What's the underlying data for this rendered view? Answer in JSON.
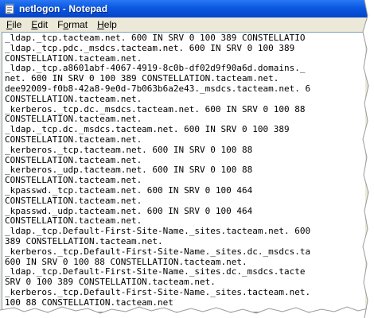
{
  "window": {
    "title": "netlogon - Notepad"
  },
  "menu": [
    {
      "first": "F",
      "rest": "ile"
    },
    {
      "first": "E",
      "rest": "dit"
    },
    {
      "first": "F",
      "rest": "ormat",
      "underline_index": 1
    },
    {
      "first": "H",
      "rest": "elp"
    }
  ],
  "menu_labels": [
    "File",
    "Edit",
    "Format",
    "Help"
  ],
  "editor": {
    "lines": [
      "_ldap._tcp.tacteam.net. 600 IN SRV 0 100 389 CONSTELLATIO",
      "_ldap._tcp.pdc._msdcs.tacteam.net. 600 IN SRV 0 100 389",
      "CONSTELLATION.tacteam.net.",
      "_ldap._tcp.a8601abf-4067-4919-8c0b-df02d9f90a6d.domains._",
      "net. 600 IN SRV 0 100 389 CONSTELLATION.tacteam.net.",
      "dee92009-f0b8-42a8-9e0d-7b063b6a2e43._msdcs.tacteam.net. 6",
      "CONSTELLATION.tacteam.net.",
      "_kerberos._tcp.dc._msdcs.tacteam.net. 600 IN SRV 0 100 88",
      "CONSTELLATION.tacteam.net.",
      "_ldap._tcp.dc._msdcs.tacteam.net. 600 IN SRV 0 100 389",
      "CONSTELLATION.tacteam.net.",
      "_kerberos._tcp.tacteam.net. 600 IN SRV 0 100 88",
      "CONSTELLATION.tacteam.net.",
      "_kerberos._udp.tacteam.net. 600 IN SRV 0 100 88",
      "CONSTELLATION.tacteam.net.",
      "_kpasswd._tcp.tacteam.net. 600 IN SRV 0 100 464",
      "CONSTELLATION.tacteam.net.",
      "_kpasswd._udp.tacteam.net. 600 IN SRV 0 100 464",
      "CONSTELLATION.tacteam.net.",
      "_ldap._tcp.Default-First-Site-Name._sites.tacteam.net. 600",
      "389 CONSTELLATION.tacteam.net.",
      "_kerberos._tcp.Default-First-Site-Name._sites.dc._msdcs.ta",
      "600 IN SRV 0 100 88 CONSTELLATION.tacteam.net.",
      "_ldap._tcp.Default-First-Site-Name._sites.dc._msdcs.tacte",
      "SRV 0 100 389 CONSTELLATION.tacteam.net.",
      "_kerberos._tcp.Default-First-Site-Name._sites.tacteam.net.",
      "100 88 CONSTELLATION.tacteam.net"
    ]
  },
  "colors": {
    "titlebar": "#0a58e0",
    "menubar": "#ece9d8",
    "editor_bg": "#ffffff",
    "text": "#000000"
  },
  "icons": {
    "app": "notepad-icon"
  }
}
